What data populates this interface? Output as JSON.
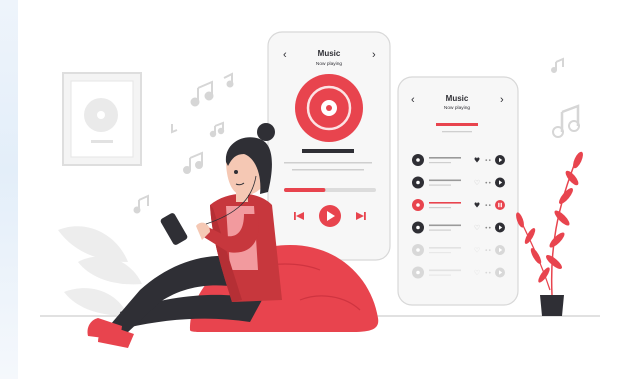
{
  "phone_left": {
    "title": "Music",
    "subtitle": "Now playing",
    "back_icon": "chevron-left-icon",
    "forward_icon": "chevron-right-icon",
    "progress": 0.45
  },
  "phone_right": {
    "title": "Music",
    "subtitle": "Now playing",
    "tracks": [
      {
        "state": "normal",
        "favorite": true
      },
      {
        "state": "normal",
        "favorite": false
      },
      {
        "state": "playing",
        "favorite": true
      },
      {
        "state": "normal",
        "favorite": false
      },
      {
        "state": "faded",
        "favorite": false
      },
      {
        "state": "faded",
        "favorite": false
      }
    ]
  },
  "colors": {
    "accent": "#e8444e",
    "dark": "#2f2f35",
    "gray": "#d0d0d0",
    "background": "#ffffff",
    "panel": "#f7f7f7"
  }
}
